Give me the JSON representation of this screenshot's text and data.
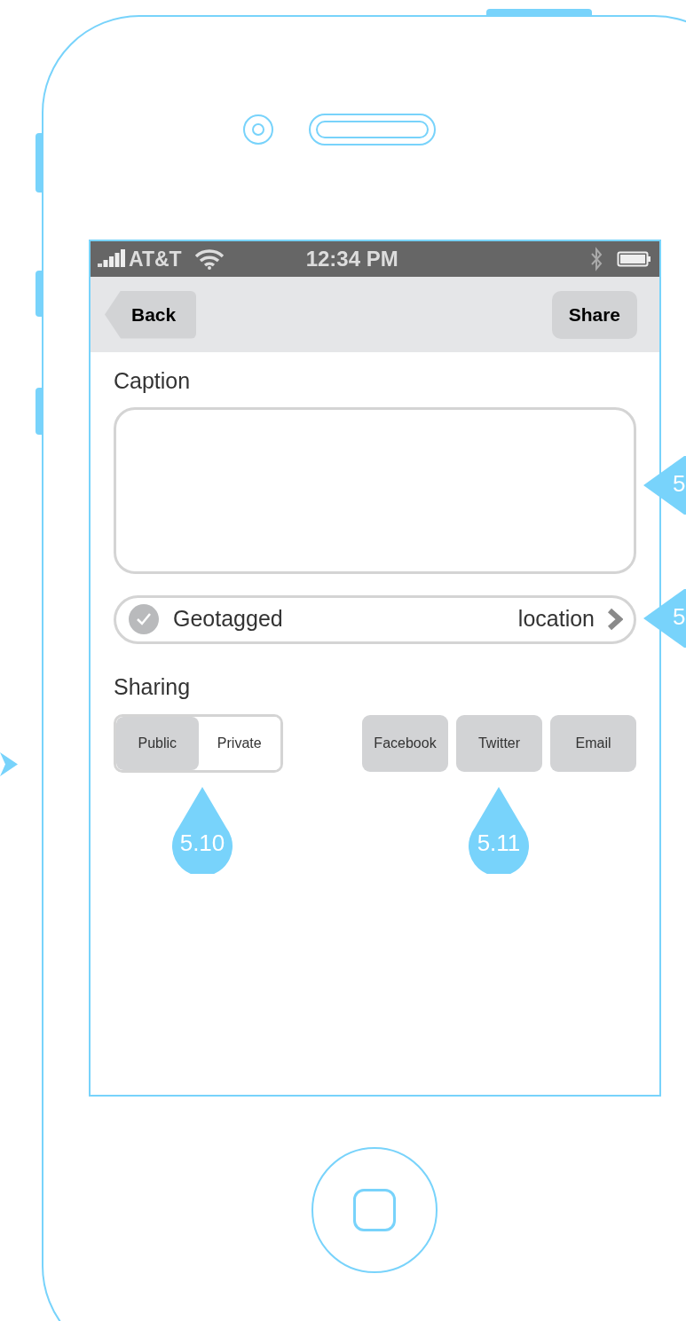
{
  "status_bar": {
    "carrier": "AT&T",
    "time": "12:34 PM"
  },
  "nav": {
    "back": "Back",
    "action": "Share"
  },
  "caption": {
    "label": "Caption"
  },
  "geotag": {
    "label": "Geotagged",
    "checked": true,
    "value": "location"
  },
  "sharing": {
    "label": "Sharing",
    "privacy": [
      {
        "label": "Public",
        "selected": true
      },
      {
        "label": "Private",
        "selected": false
      }
    ],
    "services": [
      {
        "label": "Facebook"
      },
      {
        "label": "Twitter"
      },
      {
        "label": "Email"
      }
    ]
  },
  "callouts_below": [
    {
      "label": "5.10"
    },
    {
      "label": "5.11"
    }
  ],
  "callouts_right": [
    {
      "label": "5"
    },
    {
      "label": "5"
    }
  ]
}
